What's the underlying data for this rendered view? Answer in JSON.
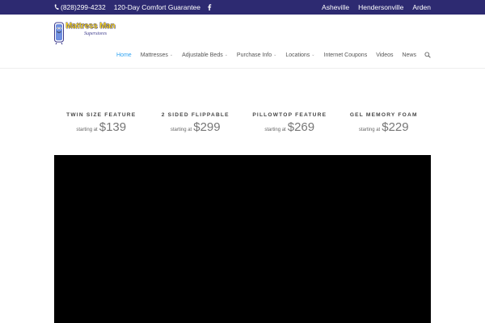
{
  "topbar": {
    "phone": "(828)299-4232",
    "guarantee": "120-Day Comfort Guarantee",
    "locations": [
      "Asheville",
      "Hendersonville",
      "Arden"
    ]
  },
  "logo": {
    "name": "Mattress Man",
    "tagline": "Superstores"
  },
  "nav": {
    "items": [
      {
        "label": "Home",
        "active": true,
        "dropdown": false
      },
      {
        "label": "Mattresses",
        "dropdown": true
      },
      {
        "label": "Adjustable Beds",
        "dropdown": true
      },
      {
        "label": "Purchase Info",
        "dropdown": true
      },
      {
        "label": "Locations",
        "dropdown": true
      },
      {
        "label": "Internet Coupons",
        "dropdown": false
      },
      {
        "label": "Videos",
        "dropdown": false
      },
      {
        "label": "News",
        "dropdown": false
      }
    ],
    "caret": "⌄"
  },
  "features": [
    {
      "title": "TWIN SIZE FEATURE",
      "starting": "starting at",
      "price": "$139"
    },
    {
      "title": "2 SIDED FLIPPABLE",
      "starting": "starting at",
      "price": "$299"
    },
    {
      "title": "PILLOWTOP FEATURE",
      "starting": "starting at",
      "price": "$269"
    },
    {
      "title": "GEL MEMORY FOAM",
      "starting": "starting at",
      "price": "$229"
    }
  ],
  "colors": {
    "topbar": "#2d2a71",
    "active_nav": "#2ea3f2"
  },
  "icons": {
    "phone": "phone-icon",
    "social": "facebook-icon",
    "search": "search-icon"
  }
}
